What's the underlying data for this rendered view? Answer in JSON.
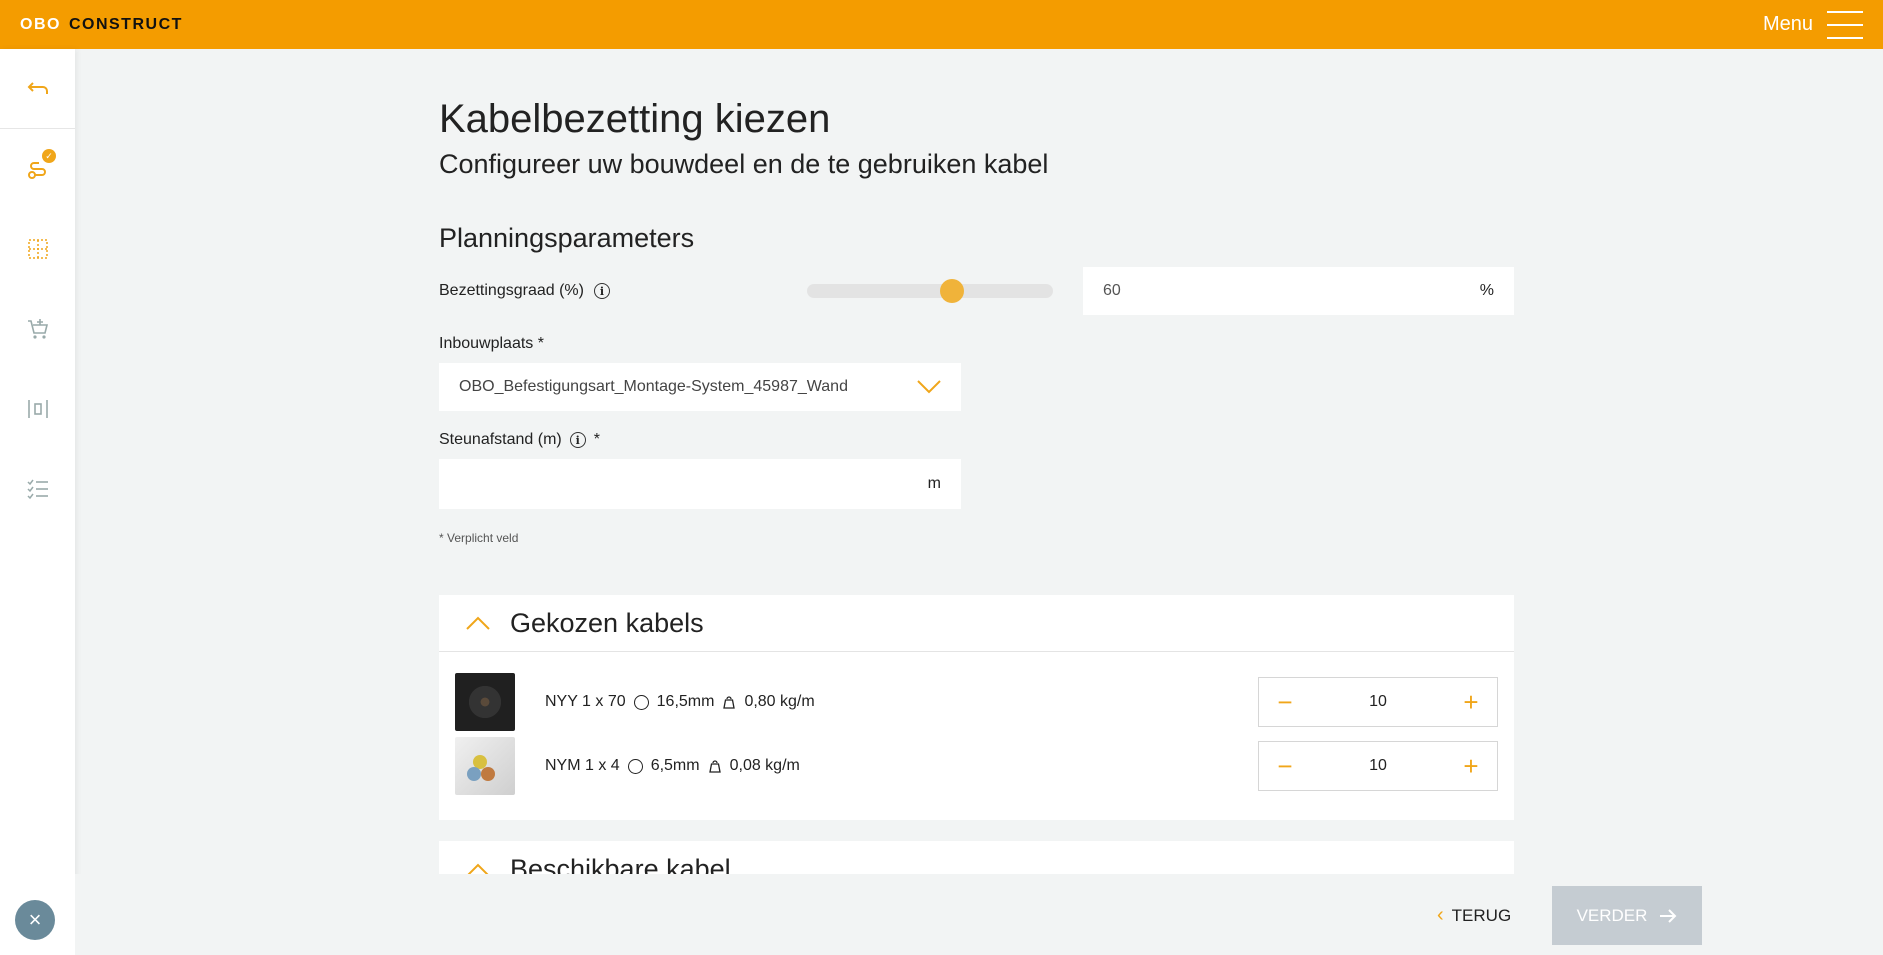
{
  "header": {
    "brand_left": "OBO",
    "brand_right": "CONSTRUCT",
    "menu_label": "Menu"
  },
  "page": {
    "title": "Kabelbezetting kiezen",
    "subtitle": "Configureer uw bouwdeel en de te gebruiken kabel"
  },
  "planning": {
    "section_title": "Planningsparameters",
    "occupancy_label": "Bezettingsgraad (%)",
    "occupancy_value": "60",
    "occupancy_unit": "%",
    "occupancy_fraction": 0.6,
    "mounting_label": "Inbouwplaats *",
    "mounting_value": "OBO_Befestigungsart_Montage-System_45987_Wand",
    "support_label": "Steunafstand (m)",
    "support_required": "*",
    "support_unit": "m",
    "required_note": "* Verplicht veld"
  },
  "chosen_cables": {
    "title": "Gekozen kabels",
    "items": [
      {
        "name": "NYY 1 x 70",
        "diameter": "16,5mm",
        "weight": "0,80 kg/m",
        "quantity": "10"
      },
      {
        "name": "NYM 1 x 4",
        "diameter": "6,5mm",
        "weight": "0,08 kg/m",
        "quantity": "10"
      }
    ]
  },
  "available_cables": {
    "title": "Beschikbare kabel"
  },
  "footer": {
    "back_label": "TERUG",
    "next_label": "VERDER"
  },
  "colors": {
    "accent": "#f49c00",
    "icon": "#f0a61a",
    "disabled_button": "#c5ccd2"
  }
}
